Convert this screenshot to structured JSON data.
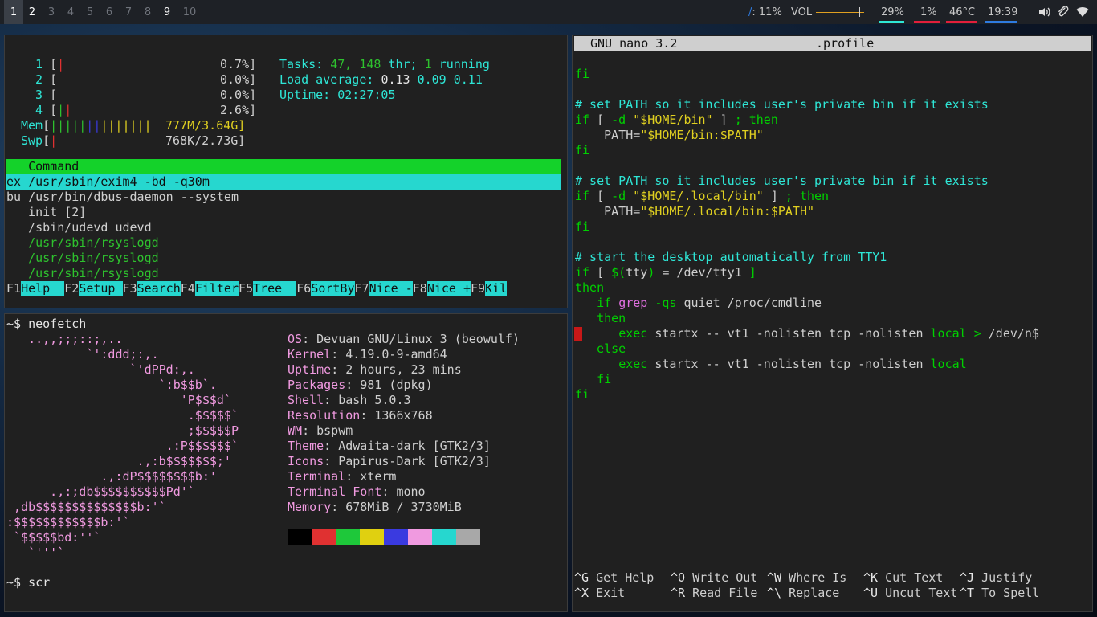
{
  "panel": {
    "workspaces": [
      {
        "label": "1",
        "state": "active"
      },
      {
        "label": "2",
        "state": "occupied"
      },
      {
        "label": "3",
        "state": "empty"
      },
      {
        "label": "4",
        "state": "empty"
      },
      {
        "label": "5",
        "state": "empty"
      },
      {
        "label": "6",
        "state": "empty"
      },
      {
        "label": "7",
        "state": "empty"
      },
      {
        "label": "8",
        "state": "empty"
      },
      {
        "label": "9",
        "state": "occupied"
      },
      {
        "label": "10",
        "state": "empty"
      }
    ],
    "disk_prefix": "/",
    "disk_value": ": 11%",
    "vol_label": "VOL",
    "vol_level": 0.9,
    "cpu": "29%",
    "mem": "1%",
    "temp": "46°C",
    "clock": "19:39",
    "colors": {
      "cpu": "#2ee6d6",
      "mem": "#e01e3c",
      "temp": "#e01e3c",
      "clock": "#2e7be0",
      "vol": "#e0a020"
    },
    "tray_icons": [
      "volume-icon",
      "paperclip-icon",
      "wifi-icon"
    ]
  },
  "htop": {
    "meters": [
      {
        "label": "1",
        "bars": "|",
        "value": "0.7%]"
      },
      {
        "label": "2",
        "bars": "",
        "value": "0.0%]"
      },
      {
        "label": "3",
        "bars": "",
        "value": "0.0%]"
      },
      {
        "label": "4",
        "bars": "||",
        "value": "2.6%]"
      }
    ],
    "mem_label": "Mem",
    "mem_bars": "||||||||||||||",
    "mem_value": "777M/3.64G]",
    "swp_label": "Swp",
    "swp_bars": "|",
    "swp_value": "768K/2.73G]",
    "tasks_label": "Tasks:",
    "tasks_count": "47,",
    "thr_count": "148",
    "thr_label": "thr;",
    "running_count": "1",
    "running_label": "running",
    "load_label": "Load average:",
    "load_1": "0.13",
    "load_5": "0.09",
    "load_15": "0.11",
    "uptime_label": "Uptime:",
    "uptime_value": "02:27:05",
    "header_command": "Command",
    "processes": [
      {
        "user": "ex",
        "cmd": "/usr/sbin/exim4 -bd -q30m"
      },
      {
        "user": "bu",
        "cmd": "/usr/bin/dbus-daemon --system"
      },
      {
        "user": "",
        "cmd": "init [2]"
      },
      {
        "user": "",
        "cmd": "/sbin/udevd udevd"
      },
      {
        "user": "",
        "cmd": "/usr/sbin/rsyslogd"
      },
      {
        "user": "",
        "cmd": "/usr/sbin/rsyslogd"
      },
      {
        "user": "",
        "cmd": "/usr/sbin/rsyslogd"
      }
    ],
    "fkeys": [
      {
        "key": "F1",
        "label": "Help  "
      },
      {
        "key": "F2",
        "label": "Setup "
      },
      {
        "key": "F3",
        "label": "Search"
      },
      {
        "key": "F4",
        "label": "Filter"
      },
      {
        "key": "F5",
        "label": "Tree  "
      },
      {
        "key": "F6",
        "label": "SortBy"
      },
      {
        "key": "F7",
        "label": "Nice -"
      },
      {
        "key": "F8",
        "label": "Nice +"
      },
      {
        "key": "F9",
        "label": "Kil"
      }
    ]
  },
  "neofetch": {
    "prompt_1": "~$ neofetch",
    "art": [
      "   ..,,;;;::;,..",
      "           `':ddd;:,.",
      "                 `'dPPd:,.",
      "                     `:b$$b`.",
      "                        'P$$$d`",
      "                         .$$$$$`",
      "                         ;$$$$$P",
      "                      .:P$$$$$$`",
      "                  .,:b$$$$$$$;'",
      "             .,:dP$$$$$$$$b:'",
      "      .,:;db$$$$$$$$$$Pd'`",
      " ,db$$$$$$$$$$$$$$b:'`",
      ":$$$$$$$$$$$$b:'`",
      " `$$$$$bd:''`",
      "   `'''`"
    ],
    "info": [
      {
        "key": "OS",
        "value": " Devuan GNU/Linux 3 (beowulf)"
      },
      {
        "key": "Kernel",
        "value": " 4.19.0-9-amd64"
      },
      {
        "key": "Uptime",
        "value": " 2 hours, 23 mins"
      },
      {
        "key": "Packages",
        "value": " 981 (dpkg)"
      },
      {
        "key": "Shell",
        "value": " bash 5.0.3"
      },
      {
        "key": "Resolution",
        "value": " 1366x768"
      },
      {
        "key": "WM",
        "value": " bspwm"
      },
      {
        "key": "Theme",
        "value": " Adwaita-dark [GTK2/3]"
      },
      {
        "key": "Icons",
        "value": " Papirus-Dark [GTK2/3]"
      },
      {
        "key": "Terminal",
        "value": " xterm"
      },
      {
        "key": "Terminal Font",
        "value": " mono"
      },
      {
        "key": "Memory",
        "value": " 678MiB / 3730MiB"
      }
    ],
    "palette": [
      "#000000",
      "#e03131",
      "#1ec83a",
      "#e0d010",
      "#3a3ae0",
      "#f09ae0",
      "#26d7cf",
      "#a8a8a8"
    ],
    "prompt_2": "~$ scr"
  },
  "nano": {
    "version": "GNU nano 3.2",
    "filename": ".profile",
    "shortcuts_row1": [
      {
        "key": "^G",
        "label": "Get Help"
      },
      {
        "key": "^O",
        "label": "Write Out"
      },
      {
        "key": "^W",
        "label": "Where Is"
      },
      {
        "key": "^K",
        "label": "Cut Text"
      },
      {
        "key": "^J",
        "label": "Justify"
      }
    ],
    "shortcuts_row2": [
      {
        "key": "^X",
        "label": "Exit"
      },
      {
        "key": "^R",
        "label": "Read File"
      },
      {
        "key": "^\\",
        "label": "Replace"
      },
      {
        "key": "^U",
        "label": "Uncut Text"
      },
      {
        "key": "^T",
        "label": "To Spell"
      }
    ]
  }
}
